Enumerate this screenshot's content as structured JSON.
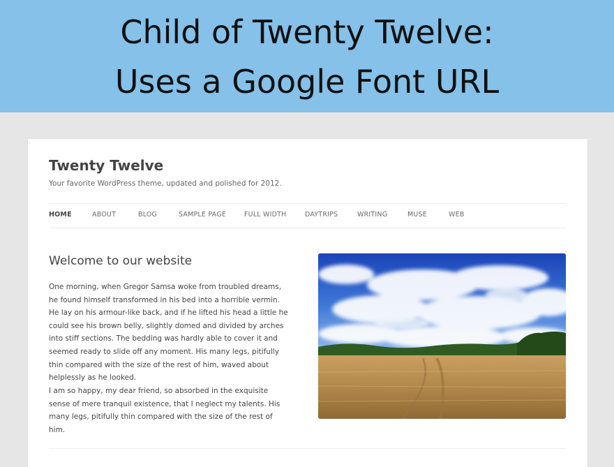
{
  "banner": {
    "line1": "Child of Twenty Twelve:",
    "line2": "Uses a Google Font URL"
  },
  "site": {
    "title": "Twenty Twelve",
    "description": "Your favorite WordPress theme, updated and polished for 2012."
  },
  "nav": {
    "items": [
      "HOME",
      "ABOUT",
      "BLOG",
      "SAMPLE PAGE",
      "FULL WIDTH",
      "DAYTRIPS",
      "WRITING",
      "MUSE",
      "WEB"
    ],
    "active": "HOME"
  },
  "content": {
    "heading": "Welcome to our website",
    "paragraph1": "One morning, when Gregor Samsa woke from troubled dreams, he found himself transformed in his bed into a horrible vermin. He lay on his armour-like back, and if he lifted his head a little he could see his brown belly, slightly domed and divided by arches into stiff sections. The bedding was hardly able to cover it and seemed ready to slide off any moment. His many legs, pitifully thin compared with the size of the rest of him, waved about helplessly as he looked.",
    "paragraph2": "I am so happy, my dear friend, so absorbed in the exquisite sense of mere tranquil existence, that I neglect my talents. His many legs, pitifully thin compared with the size of the rest of him.",
    "image": "wheat-field-blue-sky-photo"
  },
  "colors": {
    "banner_bg": "#85c1e9",
    "page_bg": "#e6e6e6",
    "text": "#444444"
  }
}
